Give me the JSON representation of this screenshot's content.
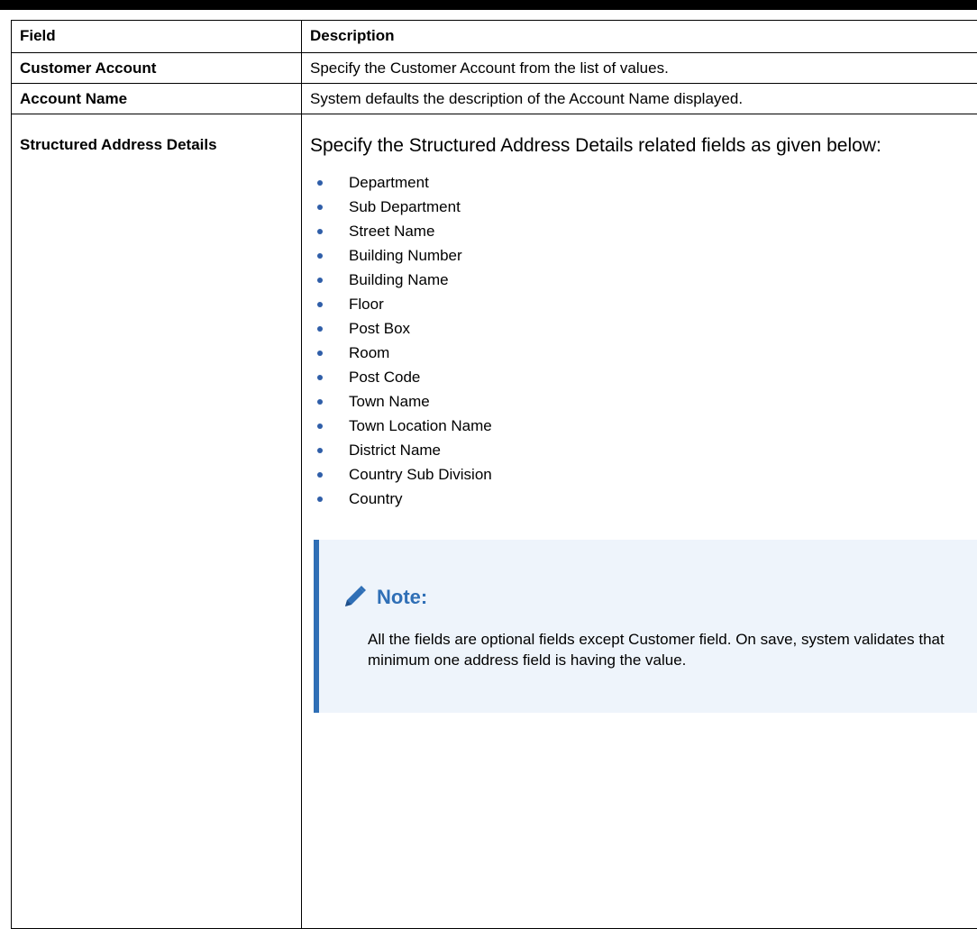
{
  "table": {
    "header": {
      "field": "Field",
      "description": "Description"
    },
    "rows": [
      {
        "field": "Customer Account",
        "description": "Specify the Customer Account from the list of values."
      },
      {
        "field": "Account Name",
        "description": "System defaults the description of the Account Name displayed."
      }
    ],
    "structured": {
      "field": "Structured Address Details",
      "intro": "Specify the Structured Address Details related fields as given below:",
      "items": [
        "Department",
        "Sub Department",
        "Street Name",
        "Building Number",
        "Building Name",
        "Floor",
        "Post Box",
        "Room",
        "Post Code",
        "Town Name",
        "Town Location Name",
        "District Name",
        "Country Sub Division",
        "Country"
      ],
      "note": {
        "icon": "pencil-icon",
        "title": "Note:",
        "text": "All the fields are optional fields except Customer field. On save, system validates that minimum one address field is having the value."
      }
    }
  },
  "colors": {
    "accent": "#2f6fb6",
    "bullet": "#2f5ea8",
    "note_bg": "#eef4fb"
  }
}
